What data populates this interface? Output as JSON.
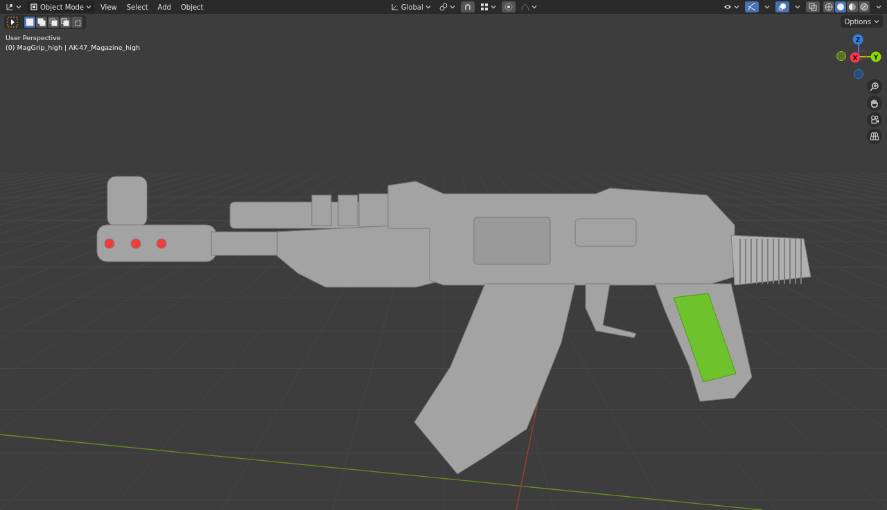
{
  "header": {
    "mode": "Object Mode",
    "menus": [
      "View",
      "Select",
      "Add",
      "Object"
    ],
    "orientation": "Global",
    "gizmo_on": true,
    "overlays_on": true,
    "xray_on": false
  },
  "shading": [
    {
      "selected": false
    },
    {
      "selected": true
    },
    {
      "selected": false
    },
    {
      "selected": false
    }
  ],
  "select_modes": [
    {
      "selected": true
    },
    {
      "selected": false
    },
    {
      "selected": false
    },
    {
      "selected": false
    },
    {
      "selected": false
    }
  ],
  "options": "Options",
  "viewport": {
    "perspective": "User Perspective",
    "object_info": "(0) MagGrip_high | AK-47_Magazine_high"
  },
  "gizmo_axes": [
    {
      "label": "Z",
      "color": "#2f83e3"
    },
    {
      "label": "X",
      "color": "#ff3352"
    },
    {
      "label": "Y",
      "color": "#8bdc00"
    }
  ]
}
